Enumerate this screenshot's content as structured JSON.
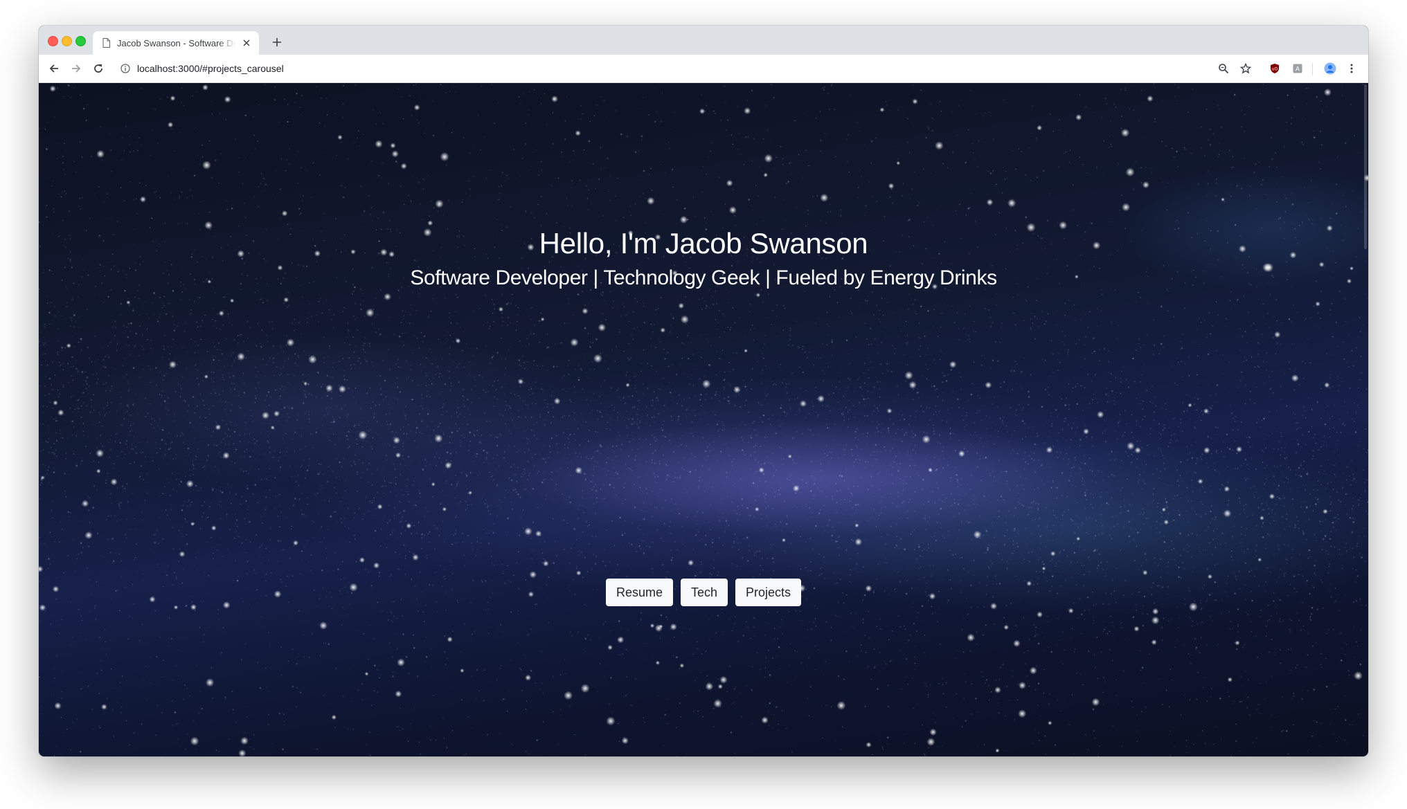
{
  "browser": {
    "tab": {
      "title": "Jacob Swanson - Software Developer",
      "close_icon": "close-icon",
      "favicon": "document-icon"
    },
    "new_tab_icon": "plus-icon",
    "url": "localhost:3000/#projects_carousel",
    "nav_icons": [
      "back-arrow-icon",
      "forward-arrow-icon",
      "reload-icon"
    ],
    "toolbar_icons": [
      "zoom-icon",
      "star-icon",
      "ublock-icon",
      "extension-icon",
      "profile-icon",
      "menu-icon"
    ]
  },
  "hero": {
    "title": "Hello, I'm Jacob Swanson",
    "subtitle": "Software Developer | Technology Geek | Fueled by Energy Drinks",
    "buttons": [
      {
        "label": "Resume"
      },
      {
        "label": "Tech"
      },
      {
        "label": "Projects"
      }
    ]
  },
  "colors": {
    "tabstrip": "#dee1e6",
    "button_bg": "#f8f9fa",
    "hero_text": "#ffffff"
  }
}
